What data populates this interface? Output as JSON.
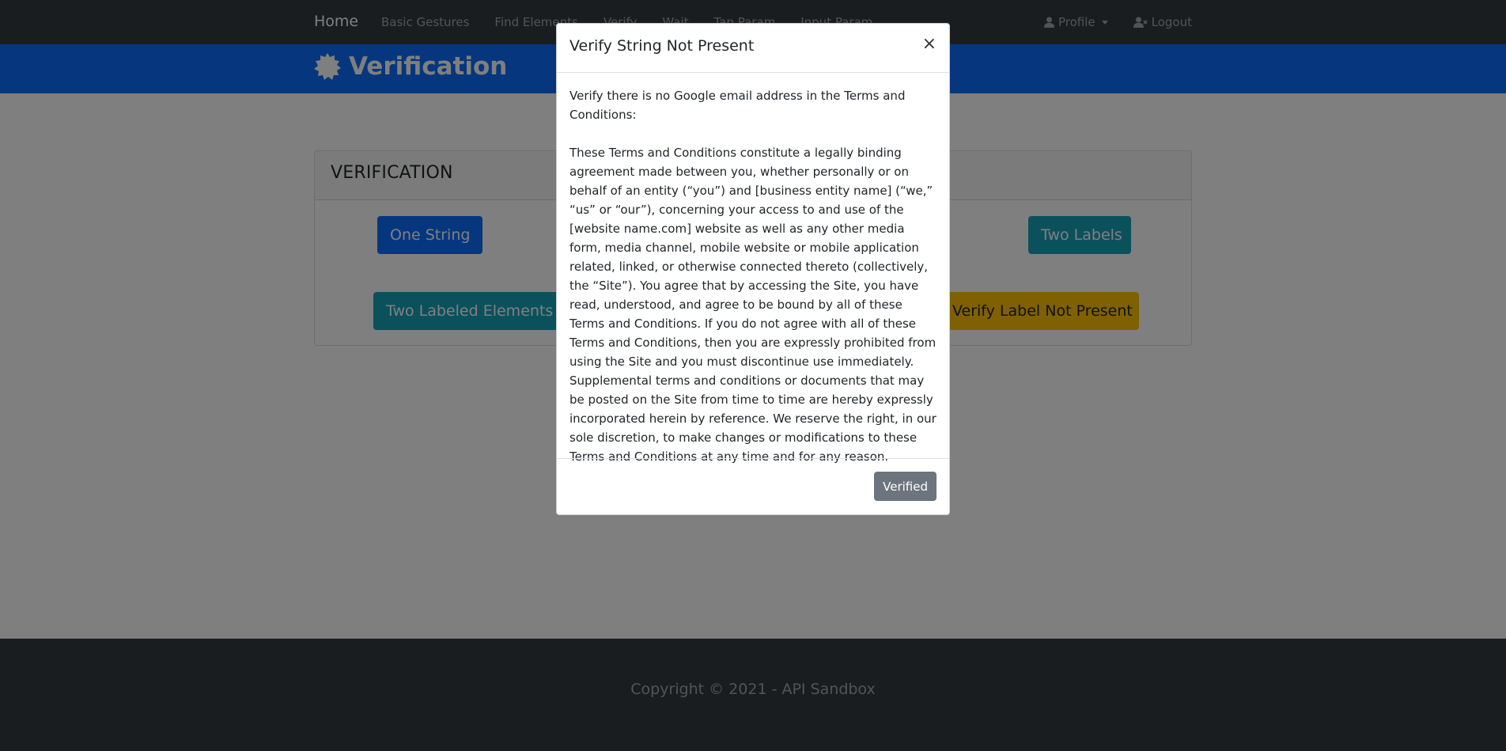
{
  "navbar": {
    "brand": "Home",
    "links": [
      "Basic Gestures",
      "Find Elements",
      "Verify",
      "Wait",
      "Tap Param",
      "Input Param"
    ],
    "profile_label": "Profile",
    "logout_label": "Logout"
  },
  "hero": {
    "title": "Verification"
  },
  "card": {
    "title": "VERIFICATION",
    "buttons": {
      "one_string": "One String",
      "two_labels": "Two Labels",
      "two_labeled_elements": "Two Labeled Elements",
      "verify_label_not_present": "Verify Label Not Present"
    }
  },
  "footer": {
    "copyright": "Copyright © 2021 - API Sandbox"
  },
  "modal": {
    "title": "Verify String Not Present",
    "close_symbol": "×",
    "intro": "Verify there is no Google email address in the Terms and Conditions:",
    "body": "These Terms and Conditions constitute a legally binding agreement made between you, whether personally or on behalf of an entity (“you”) and [business entity name] (“we,” “us” or “our”), concerning your access to and use of the [website name.com] website as well as any other media form, media channel, mobile website or mobile application related, linked, or otherwise connected thereto (collectively, the “Site”). You agree that by accessing the Site, you have read, understood, and agree to be bound by all of these Terms and Conditions. If you do not agree with all of these Terms and Conditions, then you are expressly prohibited from using the Site and you must discontinue use immediately. Supplemental terms and conditions or documents that may be posted on the Site from time to time are hereby expressly incorporated herein by reference. We reserve the right, in our sole discretion, to make changes or modifications to these Terms and Conditions at any time and for any reason.",
    "verified_label": "Verified"
  },
  "colors": {
    "navbar": "#343a40",
    "primary": "#0d6efd",
    "info": "#17a2b8",
    "warning": "#ffc107",
    "secondary": "#6c757d"
  }
}
